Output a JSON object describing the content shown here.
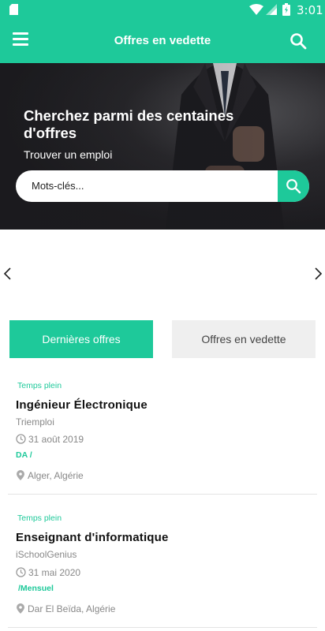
{
  "status_bar": {
    "time": "3:01"
  },
  "app_bar": {
    "title": "Offres en vedette"
  },
  "hero": {
    "headline": "Cherchez parmi des centaines d'offres",
    "subtitle": "Trouver un emploi",
    "search_placeholder": "Mots-clés..."
  },
  "tabs": [
    {
      "label": "Dernières offres",
      "active": true
    },
    {
      "label": "Offres en vedette",
      "active": false
    }
  ],
  "jobs": [
    {
      "type": "Temps plein",
      "title": "Ingénieur Électronique",
      "company": "Triemploi",
      "date": "31 août 2019",
      "salary": "DA /",
      "location": "Alger, Algérie"
    },
    {
      "type": "Temps plein",
      "title": "Enseignant d'informatique",
      "company": "iSchoolGenius",
      "date": "31 mai 2020",
      "salary": "/Mensuel",
      "location": "Dar El Beïda, Algérie"
    }
  ],
  "colors": {
    "accent": "#1ec99a",
    "tab_inactive_bg": "#efefef"
  },
  "icons": [
    "sd-card-icon",
    "wifi-icon",
    "signal-icon",
    "battery-icon",
    "menu-icon",
    "search-icon",
    "chevron-left-icon",
    "chevron-right-icon",
    "clock-icon",
    "location-pin-icon"
  ]
}
